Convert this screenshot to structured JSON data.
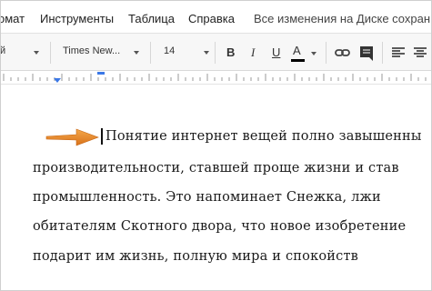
{
  "menu": {
    "items": [
      "омат",
      "Инструменты",
      "Таблица",
      "Справка"
    ],
    "save_status": "Все изменения на Диске сохран"
  },
  "toolbar": {
    "style_fragment": "й",
    "font_name": "Times New...",
    "font_size": "14",
    "bold_label": "B",
    "italic_label": "I",
    "underline_label": "U",
    "text_color_label": "A",
    "text_color": "#000000"
  },
  "icons": {
    "style_caret": "chevron-down-icon",
    "font_caret": "chevron-down-icon",
    "size_caret": "chevron-down-icon",
    "color_caret": "chevron-down-icon",
    "link": "link-icon",
    "comment": "comment-icon",
    "align_left": "align-left-icon",
    "align_center": "align-center-icon",
    "pointer": "orange-arrow-icon"
  },
  "colors": {
    "arrow": "#e8821c",
    "ruler_marker": "#3b78e7"
  },
  "document": {
    "lines": [
      "Понятие интернет вещей полно завышенны",
      "производительности, ставшей проще жизни и став",
      "промышленность. Это напоминает Снежка, лжи",
      "обитателям Скотного двора, что новое изобретение",
      "подарит им жизнь, полную мира и спокойств"
    ]
  }
}
